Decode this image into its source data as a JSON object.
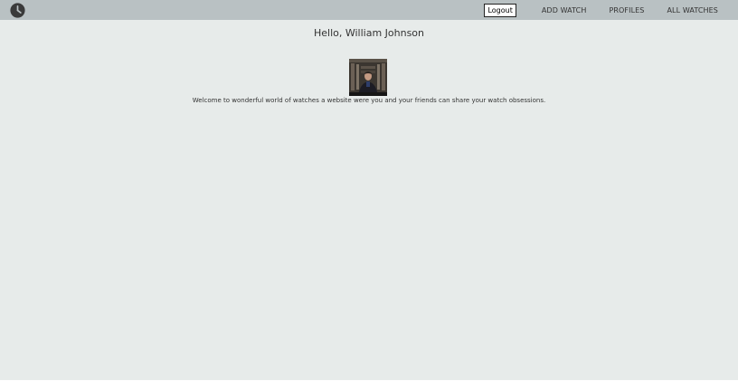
{
  "navbar": {
    "logo_icon": "clock-icon",
    "logout_label": "Logout",
    "links": {
      "add_watch": "ADD WATCH",
      "profiles": "PROFILES",
      "all_watches": "ALL WATCHES"
    }
  },
  "main": {
    "greeting": "Hello, William Johnson",
    "avatar_icon": "user-photo",
    "welcome_text": "Welcome to wonderful world of watches a website were you and your friends can share your watch obsessions."
  },
  "colors": {
    "navbar_bg": "#b9c1c3",
    "page_bg": "#e7ebea",
    "text": "#333333"
  }
}
